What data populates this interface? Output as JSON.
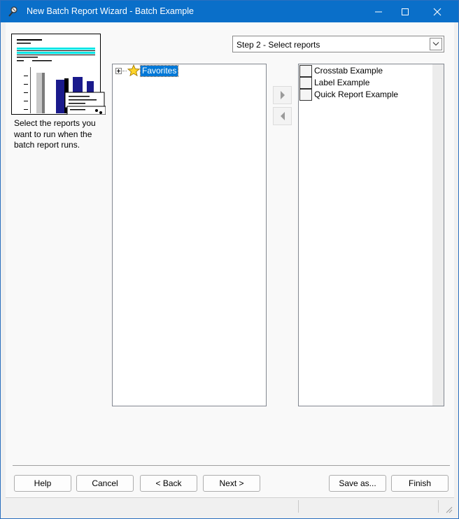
{
  "window": {
    "title": "New Batch Report Wizard - Batch Example",
    "colors": {
      "titlebar": "#0a6fc9",
      "selection": "#0078d7"
    }
  },
  "titlebar_buttons": {
    "minimize_icon": "minimize-icon",
    "maximize_icon": "maximize-icon",
    "close_icon": "close-icon"
  },
  "wizard": {
    "description": "Select the reports you want to run when the batch report runs.",
    "step_select": {
      "value": "Step 2 - Select reports"
    }
  },
  "available_tree": {
    "items": [
      {
        "label": "Favorites",
        "icon": "star-icon",
        "expanded": false,
        "selected": true
      }
    ]
  },
  "move_buttons": {
    "add_icon": "arrow-right-icon",
    "remove_icon": "arrow-left-icon"
  },
  "selected_reports": {
    "items": [
      {
        "label": "Crosstab Example",
        "checked": false
      },
      {
        "label": "Label Example",
        "checked": false
      },
      {
        "label": "Quick Report Example",
        "checked": false
      }
    ]
  },
  "buttons": {
    "help": "Help",
    "cancel": "Cancel",
    "back": "< Back",
    "next": "Next >",
    "save_as": "Save as...",
    "finish": "Finish"
  }
}
